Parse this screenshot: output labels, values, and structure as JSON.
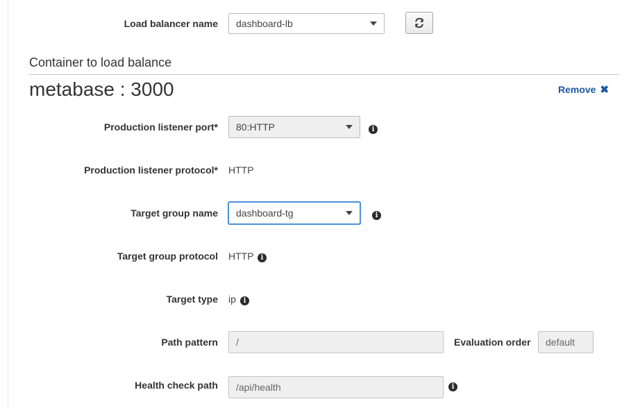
{
  "load_balancer": {
    "label": "Load balancer name",
    "selected": "dashboard-lb",
    "refresh_icon": "refresh-icon"
  },
  "section": {
    "title": "Container to load balance"
  },
  "container": {
    "title": "metabase : 3000",
    "remove_label": "Remove",
    "remove_icon": "close-icon"
  },
  "form": {
    "production_listener_port": {
      "label": "Production listener port*",
      "selected": "80:HTTP"
    },
    "production_listener_protocol": {
      "label": "Production listener protocol*",
      "value": "HTTP"
    },
    "target_group_name": {
      "label": "Target group name",
      "selected": "dashboard-tg"
    },
    "target_group_protocol": {
      "label": "Target group protocol",
      "value": "HTTP"
    },
    "target_type": {
      "label": "Target type",
      "value": "ip"
    },
    "path_pattern": {
      "label": "Path pattern",
      "value": "/"
    },
    "evaluation_order": {
      "label": "Evaluation order",
      "value": "default"
    },
    "health_check_path": {
      "label": "Health check path",
      "value": "/api/health"
    }
  },
  "info_glyph": "i",
  "remove_glyph": "✖",
  "colors": {
    "link": "#1b5aa6",
    "focus": "#4a90d9"
  }
}
